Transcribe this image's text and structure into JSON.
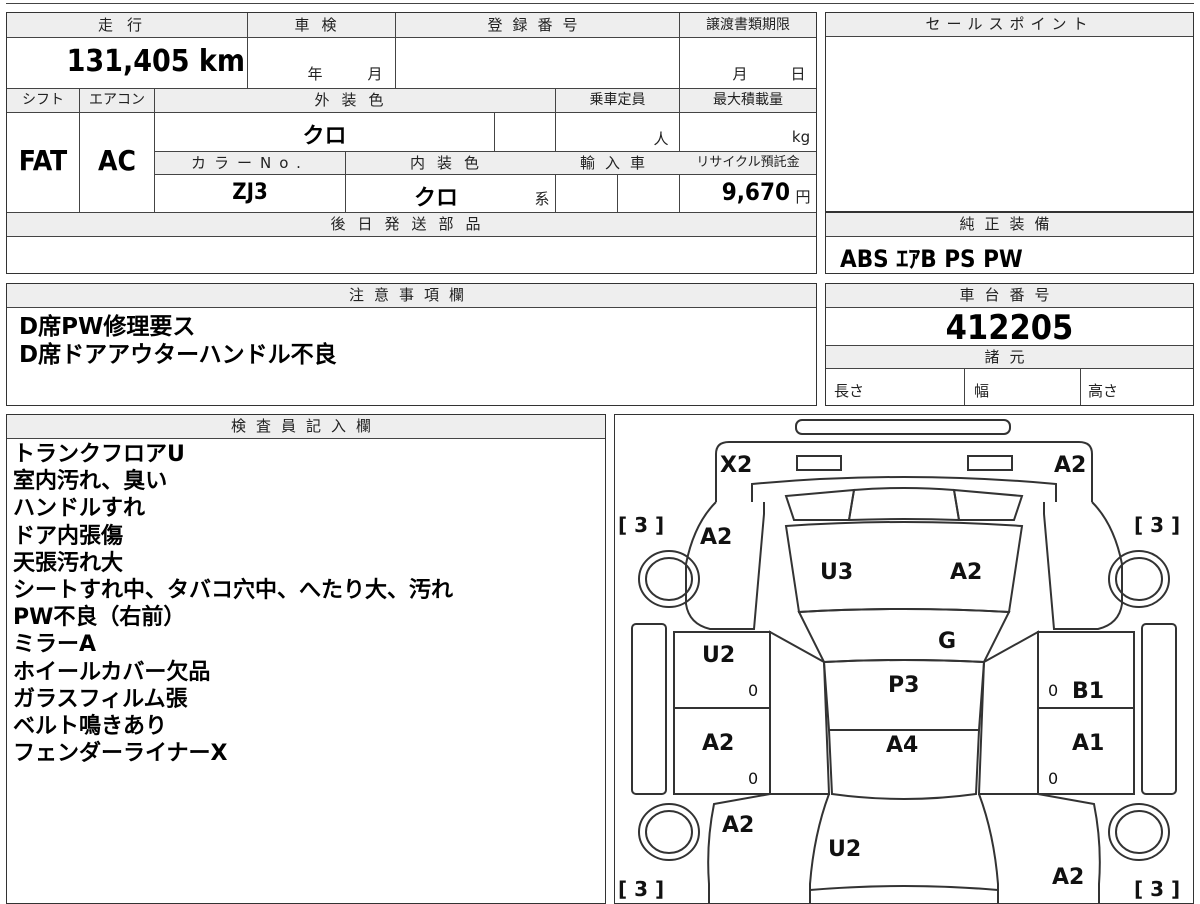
{
  "basic": {
    "mileage_label": "走行",
    "mileage_value": "131,405 km",
    "shaken_label": "車検",
    "shaken_year": "年",
    "shaken_month": "月",
    "registration_label": "登録番号",
    "transfer_label": "譲渡書類期限",
    "transfer_month": "月",
    "transfer_day": "日",
    "shift_label": "シフト",
    "shift_value": "FAT",
    "aircon_label": "エアコン",
    "aircon_value": "AC",
    "exterior_label": "外装色",
    "exterior_value": "クロ",
    "capacity_label": "乗車定員",
    "capacity_unit": "人",
    "maxload_label": "最大積載量",
    "maxload_unit": "kg",
    "color_no_label": "カラーNo.",
    "color_no_value": "ZJ3",
    "interior_label": "内装色",
    "interior_value": "クロ",
    "interior_suffix": "系",
    "import_label": "輸入車",
    "recycle_label": "リサイクル預託金",
    "recycle_value": "9,670",
    "recycle_unit": "円",
    "later_parts_label": "後日発送部品"
  },
  "sales_point": {
    "label": "セールスポイント"
  },
  "equipment": {
    "label": "純正装備",
    "value": "ABS ｴｱB PS PW"
  },
  "caution": {
    "label": "注意事項欄",
    "lines": [
      "D席PW修理要ス",
      "D席ドアアウターハンドル不良"
    ]
  },
  "chassis": {
    "label": "車台番号",
    "value": "412205"
  },
  "specs": {
    "label": "諸元",
    "length": "長さ",
    "width": "幅",
    "height": "高さ"
  },
  "inspector": {
    "label": "検査員記入欄",
    "lines": [
      "トランクフロアU",
      "室内汚れ、臭い",
      "ハンドルすれ",
      "ドア内張傷",
      "天張汚れ大",
      "シートすれ中、タバコ穴中、へたり大、汚れ",
      "PW不良（右前）",
      "ミラーA",
      "ホイールカバー欠品",
      "ガラスフィルム張",
      "ベルト鳴きあり",
      "フェンダーライナーX"
    ]
  },
  "diagram": {
    "marks": {
      "rear_left": "X2",
      "rear_right": "A2",
      "tire_rl": "[ 3 ]",
      "tire_rr": "[ 3 ]",
      "tire_fl": "[ 3 ]",
      "tire_fr": "[ 3 ]",
      "rear_quarter_left": "A2",
      "roof_left": "U3",
      "roof_right": "A2",
      "rear_door_left": "U2",
      "rear_door_left_small": "0",
      "roof_center": "P3",
      "pillar": "G",
      "rear_door_right": "B1",
      "rear_door_right_small": "0",
      "front_door_left": "A2",
      "front_door_left_small": "0",
      "front_door_right": "A1",
      "front_door_right_small": "0",
      "roof_front": "A4",
      "front_fender_left": "A2",
      "hood": "U2",
      "front_fender_right": "A2"
    }
  }
}
